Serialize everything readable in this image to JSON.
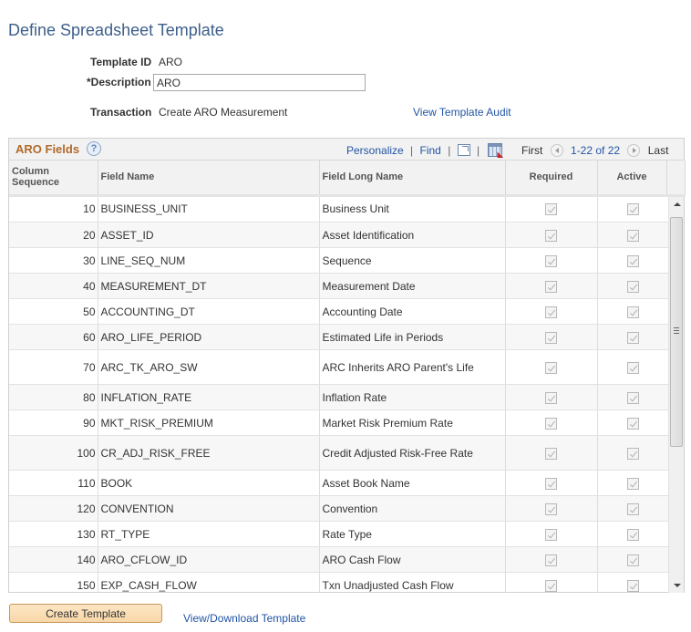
{
  "page": {
    "title": "Define Spreadsheet Template"
  },
  "form": {
    "template_id_label": "Template ID",
    "template_id_value": "ARO",
    "description_label": "*Description",
    "description_value": "ARO",
    "transaction_label": "Transaction",
    "transaction_value": "Create ARO Measurement",
    "audit_link": "View Template Audit"
  },
  "grid": {
    "title": "ARO Fields",
    "help_icon": "help-icon",
    "personalize": "Personalize",
    "find": "Find",
    "separator": "|",
    "zoom_icon": "new-window-icon",
    "download_icon": "download-to-spreadsheet-icon",
    "pager": {
      "first": "First",
      "range": "1-22 of 22",
      "last": "Last"
    },
    "columns": {
      "sequence": "Column Sequence",
      "field_name": "Field Name",
      "long_name": "Field Long Name",
      "required": "Required",
      "active": "Active"
    },
    "rows": [
      {
        "seq": "10",
        "field": "BUSINESS_UNIT",
        "long": "Business Unit",
        "required": true,
        "active": true
      },
      {
        "seq": "20",
        "field": "ASSET_ID",
        "long": "Asset Identification",
        "required": true,
        "active": true
      },
      {
        "seq": "30",
        "field": "LINE_SEQ_NUM",
        "long": "Sequence",
        "required": true,
        "active": true
      },
      {
        "seq": "40",
        "field": "MEASUREMENT_DT",
        "long": "Measurement Date",
        "required": true,
        "active": true
      },
      {
        "seq": "50",
        "field": "ACCOUNTING_DT",
        "long": "Accounting Date",
        "required": true,
        "active": true
      },
      {
        "seq": "60",
        "field": "ARO_LIFE_PERIOD",
        "long": "Estimated Life in Periods",
        "required": true,
        "active": true
      },
      {
        "seq": "70",
        "field": "ARC_TK_ARO_SW",
        "long": "ARC Inherits ARO Parent's Life",
        "required": true,
        "active": true
      },
      {
        "seq": "80",
        "field": "INFLATION_RATE",
        "long": "Inflation Rate",
        "required": true,
        "active": true
      },
      {
        "seq": "90",
        "field": "MKT_RISK_PREMIUM",
        "long": "Market Risk Premium Rate",
        "required": true,
        "active": true
      },
      {
        "seq": "100",
        "field": "CR_ADJ_RISK_FREE",
        "long": "Credit Adjusted Risk-Free Rate",
        "required": true,
        "active": true
      },
      {
        "seq": "110",
        "field": "BOOK",
        "long": "Asset Book Name",
        "required": true,
        "active": true
      },
      {
        "seq": "120",
        "field": "CONVENTION",
        "long": "Convention",
        "required": true,
        "active": true
      },
      {
        "seq": "130",
        "field": "RT_TYPE",
        "long": "Rate Type",
        "required": true,
        "active": true
      },
      {
        "seq": "140",
        "field": "ARO_CFLOW_ID",
        "long": "ARO Cash Flow",
        "required": true,
        "active": true
      },
      {
        "seq": "150",
        "field": "EXP_CASH_FLOW",
        "long": "Txn Unadjusted Cash Flow",
        "required": true,
        "active": true
      }
    ]
  },
  "footer": {
    "create_button": "Create Template",
    "download_link": "View/Download Template"
  }
}
